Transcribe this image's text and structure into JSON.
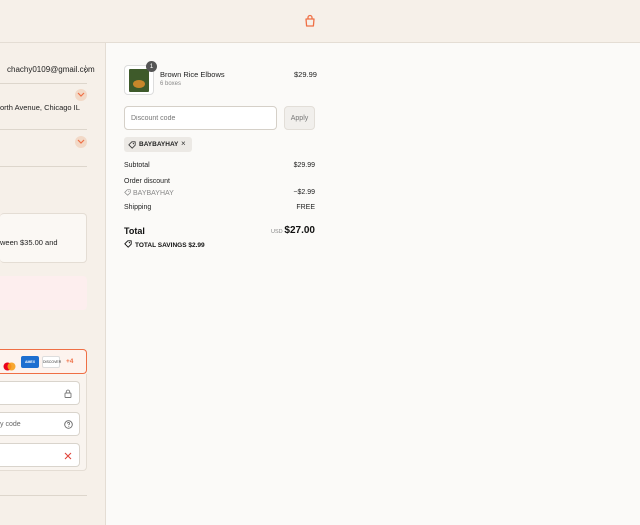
{
  "header": {
    "cart_icon": "shopping-bag-icon",
    "accent": "#ef6f45"
  },
  "left": {
    "email": "chachy0109@gmail.com",
    "address": "orth Avenue, Chicago IL",
    "shipping_note_line1": "ween $35.00 and",
    "shipping_note_line2": "",
    "payment": {
      "more_cards": "+4",
      "amex": "AMEX",
      "discover": "DISCOVER"
    },
    "fields": {
      "security_code_partial": "y code"
    }
  },
  "order": {
    "product": {
      "name": "Brown Rice Elbows",
      "variant": "6 boxes",
      "price": "$29.99",
      "quantity": "1"
    },
    "discount": {
      "placeholder": "Discount code",
      "apply_label": "Apply",
      "applied_code": "BAYBAYHAY"
    },
    "summary": {
      "subtotal_label": "Subtotal",
      "subtotal_value": "$29.99",
      "order_discount_label": "Order discount",
      "discount_code": "BAYBAYHAY",
      "discount_value": "−$2.99",
      "shipping_label": "Shipping",
      "shipping_value": "FREE",
      "total_label": "Total",
      "currency": "USD",
      "total_value": "$27.00",
      "savings_label": "TOTAL SAVINGS",
      "savings_value": "$2.99"
    }
  }
}
